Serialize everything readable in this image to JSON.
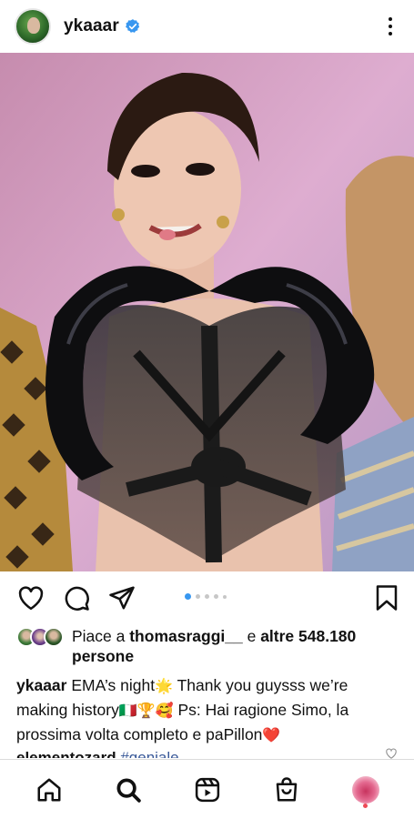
{
  "header": {
    "username": "ykaaar",
    "verified": true,
    "avatar_icon": "profile-avatar",
    "more_icon": "more-vertical-icon"
  },
  "post": {
    "image_alt_icon": "post-photo",
    "carousel": {
      "total": 6,
      "active_index": 0
    }
  },
  "actions": {
    "like_icon": "heart-icon",
    "comment_icon": "comment-icon",
    "share_icon": "send-icon",
    "save_icon": "bookmark-icon"
  },
  "likes": {
    "prefix": "Piace a ",
    "first_user": "thomasraggi__",
    "middle": " e ",
    "others": "altre 548.180",
    "suffix": "persone"
  },
  "caption": {
    "username": "ykaaar",
    "text_1": " EMA’s night",
    "emoji_1": "🌟",
    "text_2": " Thank you guysss we’re making history",
    "emoji_2": "🇮🇹🏆🥰",
    "text_3": " Ps: Hai ragione Simo, la prossima volta completo e paPillon",
    "emoji_3": "❤️"
  },
  "comment_peek": {
    "username": "elementozard",
    "tag": "#geniale"
  },
  "nav": {
    "items": [
      "home-icon",
      "search-icon",
      "reels-icon",
      "shop-icon",
      "profile-icon"
    ],
    "accent_color": "#ed4956",
    "link_color": "#385898",
    "verified_color": "#3897f0"
  }
}
